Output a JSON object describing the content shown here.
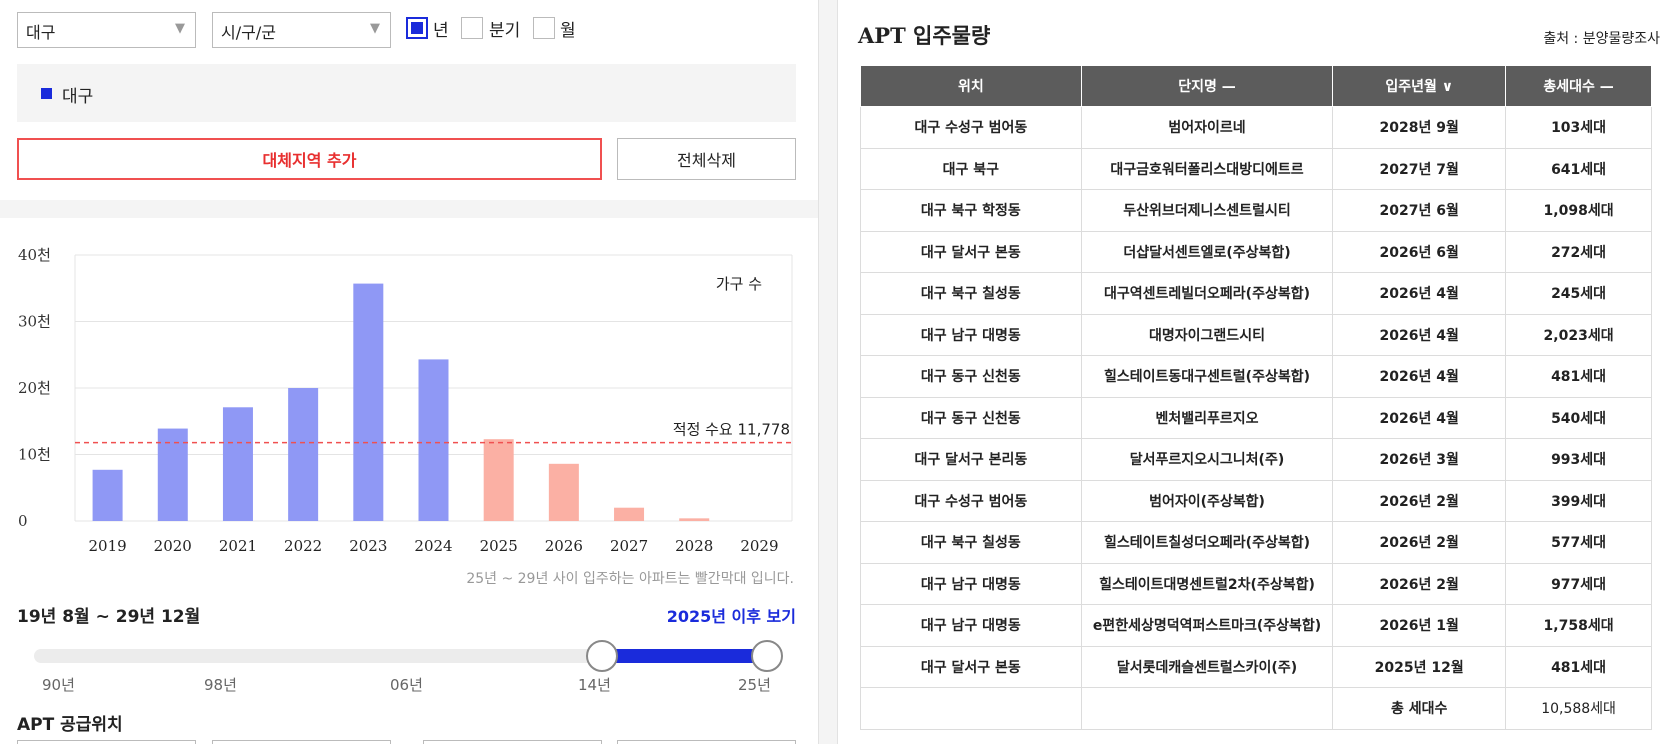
{
  "filters": {
    "region": "대구",
    "district": "시/구/군",
    "options": [
      {
        "label": "년",
        "checked": true
      },
      {
        "label": "분기",
        "checked": false
      },
      {
        "label": "월",
        "checked": false
      }
    ]
  },
  "legend": {
    "label": "대구",
    "color": "#1a2bdb"
  },
  "buttons": {
    "add": "대체지역 추가",
    "delete": "전체삭제"
  },
  "chart_data": {
    "type": "bar",
    "series_label": "가구 수",
    "categories": [
      "2019",
      "2020",
      "2021",
      "2022",
      "2023",
      "2024",
      "2025",
      "2026",
      "2027",
      "2028",
      "2029"
    ],
    "values": [
      7700,
      13900,
      17100,
      20000,
      35700,
      24300,
      12300,
      8600,
      2000,
      400,
      0
    ],
    "past_color": "#8f98f5",
    "future_color": "#fbb0a4",
    "future_from": "2025",
    "ylim": [
      0,
      40000
    ],
    "yticks": [
      {
        "v": 0,
        "label": "0"
      },
      {
        "v": 10000,
        "label": "10천"
      },
      {
        "v": 20000,
        "label": "20천"
      },
      {
        "v": 30000,
        "label": "30천"
      },
      {
        "v": 40000,
        "label": "40천"
      }
    ],
    "reference": {
      "value": 11778,
      "label": "적정 수요 11,778",
      "color": "#f05050"
    },
    "grid": true
  },
  "note": "25년 ~ 29년 사이 입주하는 아파트는 빨간막대 입니다.",
  "range": {
    "label": "19년 8월 ~ 29년 12월",
    "after_link": "2025년 이후 보기",
    "ticks": [
      "90년",
      "98년",
      "06년",
      "14년",
      "25년"
    ]
  },
  "supply_title": "APT 공급위치",
  "table": {
    "title": "APT 입주물량",
    "source": "출처 : 분양물량조사",
    "headers": [
      "위치",
      "단지명 —",
      "입주년월 ∨",
      "총세대수 —"
    ],
    "rows": [
      [
        "대구 수성구 범어동",
        "범어자이르네",
        "2028년 9월",
        "103세대"
      ],
      [
        "대구 북구",
        "대구금호워터폴리스대방디에트르",
        "2027년 7월",
        "641세대"
      ],
      [
        "대구 북구 학정동",
        "두산위브더제니스센트럴시티",
        "2027년 6월",
        "1,098세대"
      ],
      [
        "대구 달서구 본동",
        "더샵달서센트엘로(주상복합)",
        "2026년 6월",
        "272세대"
      ],
      [
        "대구 북구 칠성동",
        "대구역센트레빌더오페라(주상복합)",
        "2026년 4월",
        "245세대"
      ],
      [
        "대구 남구 대명동",
        "대명자이그랜드시티",
        "2026년 4월",
        "2,023세대"
      ],
      [
        "대구 동구 신천동",
        "힐스테이트동대구센트럴(주상복합)",
        "2026년 4월",
        "481세대"
      ],
      [
        "대구 동구 신천동",
        "벤처밸리푸르지오",
        "2026년 4월",
        "540세대"
      ],
      [
        "대구 달서구 본리동",
        "달서푸르지오시그니처(주)",
        "2026년 3월",
        "993세대"
      ],
      [
        "대구 수성구 범어동",
        "범어자이(주상복합)",
        "2026년 2월",
        "399세대"
      ],
      [
        "대구 북구 칠성동",
        "힐스테이트칠성더오페라(주상복합)",
        "2026년 2월",
        "577세대"
      ],
      [
        "대구 남구 대명동",
        "힐스테이트대명센트럴2차(주상복합)",
        "2026년 2월",
        "977세대"
      ],
      [
        "대구 남구 대명동",
        "e편한세상명덕역퍼스트마크(주상복합)",
        "2026년 1월",
        "1,758세대"
      ],
      [
        "대구 달서구 본동",
        "달서롯데캐슬센트럴스카이(주)",
        "2025년 12월",
        "481세대"
      ]
    ],
    "total_label": "총 세대수",
    "total_value": "10,588세대"
  }
}
